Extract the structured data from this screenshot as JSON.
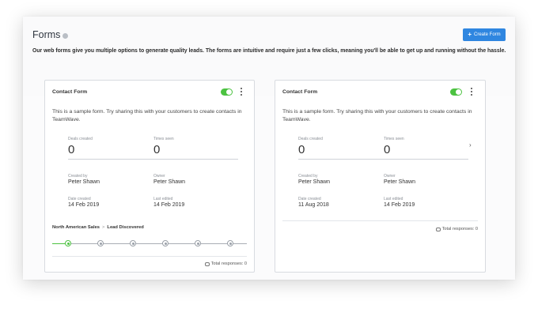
{
  "header": {
    "title": "Forms",
    "create_button": "Create Form",
    "intro": "Our web forms give you multiple options to generate quality leads. The forms are intuitive and require just a few clicks, meaning you'll be able to get up and running without the hassle."
  },
  "cards": [
    {
      "title": "Contact Form",
      "enabled": true,
      "description": "This is a sample form. Try sharing this with your customers to create contacts in TeamWave.",
      "deals_created_label": "Deals created",
      "deals_created": "0",
      "times_seen_label": "Times seen",
      "times_seen": "0",
      "created_by_label": "Created by",
      "created_by": "Peter Shawn",
      "owner_label": "Owner",
      "owner": "Peter Shawn",
      "date_created_label": "Date created",
      "date_created": "14 Feb 2019",
      "last_edited_label": "Last edited",
      "last_edited": "14 Feb 2019",
      "pipeline": "North American Sales",
      "stage": "Lead Discovered",
      "total_responses": "Total responses: 0"
    },
    {
      "title": "Contact Form",
      "enabled": true,
      "description": "This is a sample form. Try sharing this with your customers to create contacts in TeamWave.",
      "deals_created_label": "Deals created",
      "deals_created": "0",
      "times_seen_label": "Times seen",
      "times_seen": "0",
      "created_by_label": "Created by",
      "created_by": "Peter Shawn",
      "owner_label": "Owner",
      "owner": "Peter Shawn",
      "date_created_label": "Date created",
      "date_created": "11 Aug 2018",
      "last_edited_label": "Last edited",
      "last_edited": "14 Feb 2019",
      "total_responses": "Total responses: 0"
    }
  ],
  "colors": {
    "accent": "#2f86e0",
    "toggle_on": "#4cc241",
    "stage_active": "#4cc241"
  },
  "icons": [
    "info-icon",
    "plus-icon",
    "toggle-switch",
    "kebab-menu-icon",
    "chevron-right-icon",
    "chat-bubble-icon"
  ]
}
